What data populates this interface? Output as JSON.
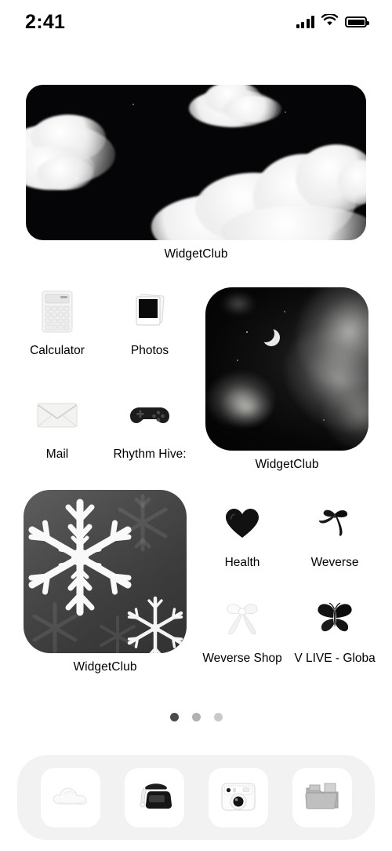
{
  "status_bar": {
    "time": "2:41",
    "signal_icon": "cellular-signal-icon",
    "wifi_icon": "wifi-icon",
    "battery_icon": "battery-full-icon"
  },
  "home_screen": {
    "widgets": [
      {
        "id": "widget-wide-clouds",
        "label": "WidgetClub",
        "size": "wide",
        "art": "black-sky-white-clouds",
        "bg_color": "#050507"
      },
      {
        "id": "widget-square-moon",
        "label": "WidgetClub",
        "size": "square",
        "art": "night-sky-crescent-moon",
        "bg_color": "#0b0b0c"
      },
      {
        "id": "widget-square-snowflake",
        "label": "WidgetClub",
        "size": "square",
        "art": "white-snowflakes-on-gray",
        "bg_color": "#4a4a4a"
      }
    ],
    "apps": [
      {
        "name": "Calculator",
        "icon": "calculator-icon"
      },
      {
        "name": "Photos",
        "icon": "polaroid-photo-icon"
      },
      {
        "name": "Mail",
        "icon": "envelope-icon"
      },
      {
        "name": "Rhythm Hive:",
        "icon": "game-controller-icon"
      },
      {
        "name": "Health",
        "icon": "black-heart-icon"
      },
      {
        "name": "Weverse",
        "icon": "black-ribbon-bow-icon"
      },
      {
        "name": "Weverse Shop",
        "icon": "white-ribbon-bow-icon"
      },
      {
        "name": "V LIVE - Globa",
        "icon": "black-butterfly-icon"
      }
    ],
    "page_dots": {
      "count": 3,
      "active_index": 0,
      "active_color": "#4a4a4a",
      "inactive_colors": [
        "#b0b0b0",
        "#c9c9c9"
      ]
    },
    "dock": {
      "background_color": "#f2f2f2",
      "tile_color": "#ffffff",
      "items": [
        {
          "name": "Weather",
          "icon": "white-cloud-icon"
        },
        {
          "name": "Phone",
          "icon": "black-telephone-icon"
        },
        {
          "name": "Camera",
          "icon": "instant-camera-icon"
        },
        {
          "name": "Files",
          "icon": "gray-folder-icon"
        }
      ]
    }
  }
}
